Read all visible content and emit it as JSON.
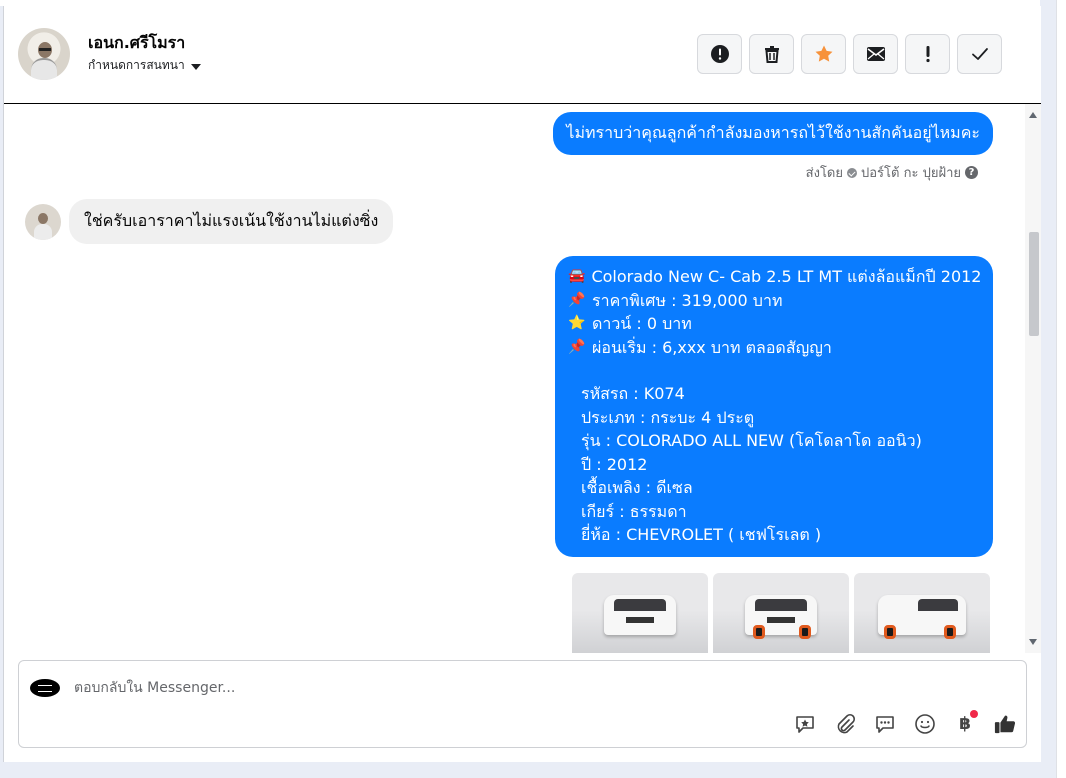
{
  "header": {
    "name": "เอนก.ศรีโมรา",
    "assign_label": "กำหนดการสนทนา",
    "toolbar": [
      {
        "icon": "alert-circle-icon"
      },
      {
        "icon": "trash-icon"
      },
      {
        "icon": "star-icon",
        "color": "#f7923b"
      },
      {
        "icon": "mail-icon"
      },
      {
        "icon": "exclamation-icon"
      },
      {
        "icon": "check-icon"
      }
    ]
  },
  "messages": {
    "outgoing_1": "ไม่ทราบว่าคุณลูกค้ากำลังมองหารถไว้ใช้งานสักคันอยู่ไหมคะ",
    "sent_by_prefix": "ส่งโดย",
    "sent_by_name": "ปอร์โต้ กะ ปุยฝ้าย",
    "incoming_1": "ใช่ครับเอาราคาไม่แรงเน้นใช้งานไม่แต่งซิ่ง",
    "car_listing": {
      "l1": "Colorado New C- Cab 2.5 LT MT แต่งล้อแม็กปี 2012",
      "l2": "ราคาพิเศษ : 319,000 บาท",
      "l3": "ดาวน์ : 0 บาท",
      "l4": "ผ่อนเริ่ม : 6,xxx บาท ตลอดสัญญา",
      "l5": "รหัสรถ : K074",
      "l6": "ประเภท : กระบะ 4 ประตู",
      "l7": "รุ่น : COLORADO ALL NEW (โคโดลาโด ออนิว)",
      "l8": "ปี : 2012",
      "l9": "เชื้อเพลิง : ดีเซล",
      "l10": "เกียร์ : ธรรมดา",
      "l11": "ยี่ห้อ : CHEVROLET ( เชฟโรเลต )"
    },
    "bubble_color": "#0a7cff"
  },
  "composer": {
    "placeholder": "ตอบกลับใน Messenger...",
    "tools": [
      "saved-reply-icon",
      "attachment-icon",
      "quick-reply-icon",
      "emoji-icon",
      "baht-payment-icon",
      "thumbs-up-icon"
    ],
    "baht_symbol": "฿"
  }
}
